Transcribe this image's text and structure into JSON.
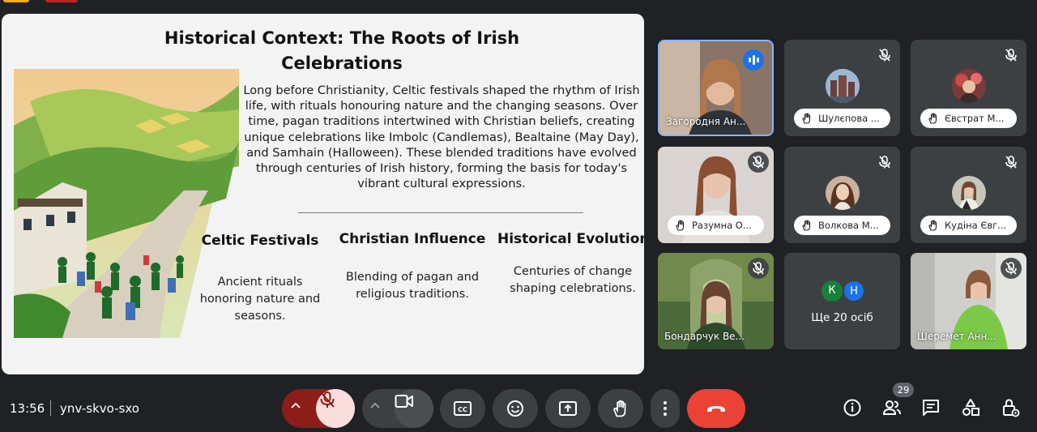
{
  "slide": {
    "title": "Historical Context: The Roots of Irish Celebrations",
    "body": "Long before Christianity, Celtic festivals shaped the rhythm of Irish life, with rituals honouring nature and the changing seasons. Over time, pagan traditions intertwined with Christian beliefs, creating unique celebrations like Imbolc (Candlemas), Bealtaine (May Day), and Samhain (Halloween). These blended traditions have evolved through centuries of Irish history, forming the basis for today's vibrant cultural expressions.",
    "columns": [
      {
        "heading": "Celtic Festivals",
        "text": "Ancient rituals honoring nature and seasons."
      },
      {
        "heading": "Christian Influence",
        "text": "Blending of pagan and religious traditions."
      },
      {
        "heading": "Historical Evolution",
        "text": "Centuries of change shaping celebrations."
      }
    ]
  },
  "participants": [
    {
      "name": "Загородня Ан...",
      "speaking": true
    },
    {
      "name": "Шулєпова ...",
      "hand_raised": true,
      "muted": true
    },
    {
      "name": "Євстрат М...",
      "hand_raised": true,
      "muted": true
    },
    {
      "name": "Разумна О...",
      "hand_raised": true,
      "muted": true
    },
    {
      "name": "Волкова М...",
      "hand_raised": true,
      "muted": true
    },
    {
      "name": "Кудіна Євг...",
      "hand_raised": true,
      "muted": true
    },
    {
      "name": "Бондарчук Ве...",
      "muted": true
    },
    {
      "name": "Шеремет Анн...",
      "muted": true
    }
  ],
  "others_tile": {
    "initials": [
      "К",
      "Н"
    ],
    "label": "Ще 20 осіб"
  },
  "meeting": {
    "time": "13:56",
    "code": "ynv-skvo-sxo",
    "participant_count": "29"
  },
  "colors": {
    "background": "#202124",
    "tile": "#3c4043",
    "end_call": "#ea4335",
    "mic_off_bg": "#f9dedc",
    "active_border": "#8ab4f8"
  },
  "icons": [
    "chevron-up-icon",
    "mic-off-icon",
    "camera-icon",
    "captions-icon",
    "emoji-icon",
    "present-icon",
    "hand-icon",
    "more-icon",
    "hang-up-icon",
    "info-icon",
    "people-icon",
    "chat-icon",
    "activities-icon",
    "host-controls-icon"
  ]
}
